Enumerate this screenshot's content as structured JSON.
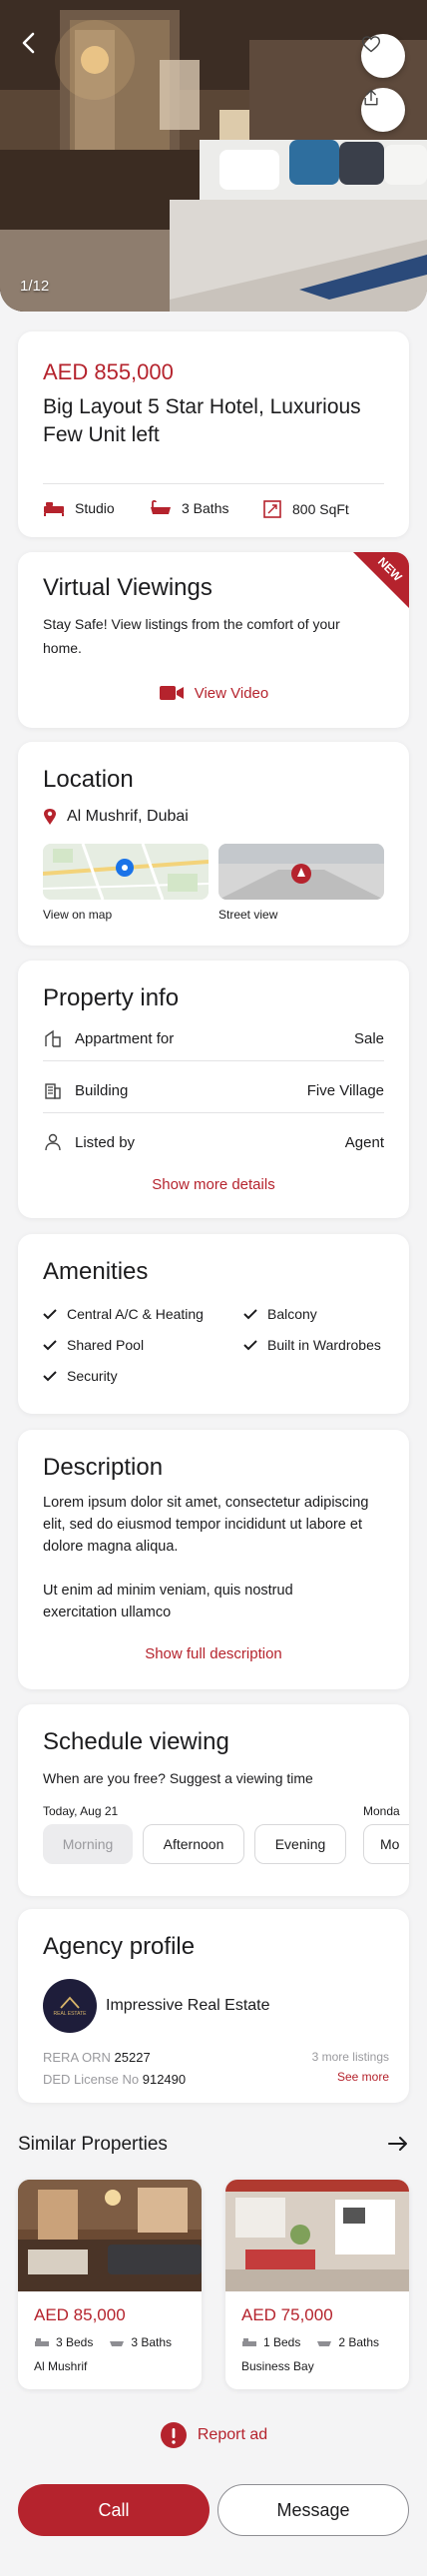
{
  "gallery": {
    "counter": "1/12"
  },
  "overview": {
    "price": "AED 855,000",
    "title": "Big Layout 5 Star Hotel, Luxurious Few Unit left",
    "specs": [
      {
        "icon": "bed-icon",
        "label": "Studio"
      },
      {
        "icon": "bathtub-icon",
        "label": "3 Baths"
      },
      {
        "icon": "area-icon",
        "label": "800 SqFt"
      }
    ]
  },
  "virtual": {
    "title": "Virtual Viewings",
    "badge": "NEW",
    "text": "Stay Safe! View listings from the comfort of your home.",
    "link": "View Video"
  },
  "location": {
    "title": "Location",
    "address": "Al Mushrif, Dubai",
    "map_label": "View on map",
    "street_label": "Street view"
  },
  "property_info": {
    "title": "Property info",
    "rows": [
      {
        "icon": "building-type-icon",
        "label": "Appartment for",
        "value": "Sale"
      },
      {
        "icon": "building-icon",
        "label": "Building",
        "value": "Five Village"
      },
      {
        "icon": "person-icon",
        "label": "Listed by",
        "value": "Agent"
      }
    ],
    "more": "Show more details"
  },
  "amenities": {
    "title": "Amenities",
    "items": [
      "Central A/C & Heating",
      "Balcony",
      "Shared Pool",
      "Built in Wardrobes",
      "Security"
    ]
  },
  "description": {
    "title": "Description",
    "p1": "Lorem ipsum dolor sit amet, consectetur adipiscing elit, sed do eiusmod tempor incididunt ut labore et dolore magna aliqua.",
    "p2": "Ut enim ad minim veniam, quis nostrud exercitation ullamco",
    "more": "Show full description"
  },
  "schedule": {
    "title": "Schedule viewing",
    "subtitle": "When are you free? Suggest a viewing time",
    "day1": "Today, Aug 21",
    "day2": "Monda",
    "slots": [
      "Morning",
      "Afternoon",
      "Evening",
      "Mo"
    ]
  },
  "agency": {
    "title": "Agency profile",
    "name": "Impressive Real Estate",
    "logo_text": "REAL ESTATE",
    "rera_label": "RERA ORN",
    "rera_value": "25227",
    "ded_label": "DED License No",
    "ded_value": "912490",
    "listings": "3 more listings",
    "see_more": "See more"
  },
  "similar": {
    "title": "Similar Properties",
    "items": [
      {
        "price": "AED 85,000",
        "beds": "3 Beds",
        "baths": "3 Baths",
        "location": "Al Mushrif"
      },
      {
        "price": "AED 75,000",
        "beds": "1 Beds",
        "baths": "2 Baths",
        "location": "Business Bay"
      }
    ]
  },
  "report": "Report ad",
  "actions": {
    "call": "Call",
    "message": "Message"
  },
  "colors": {
    "brand_red": "#b5232d",
    "background": "#f4f4f5"
  }
}
